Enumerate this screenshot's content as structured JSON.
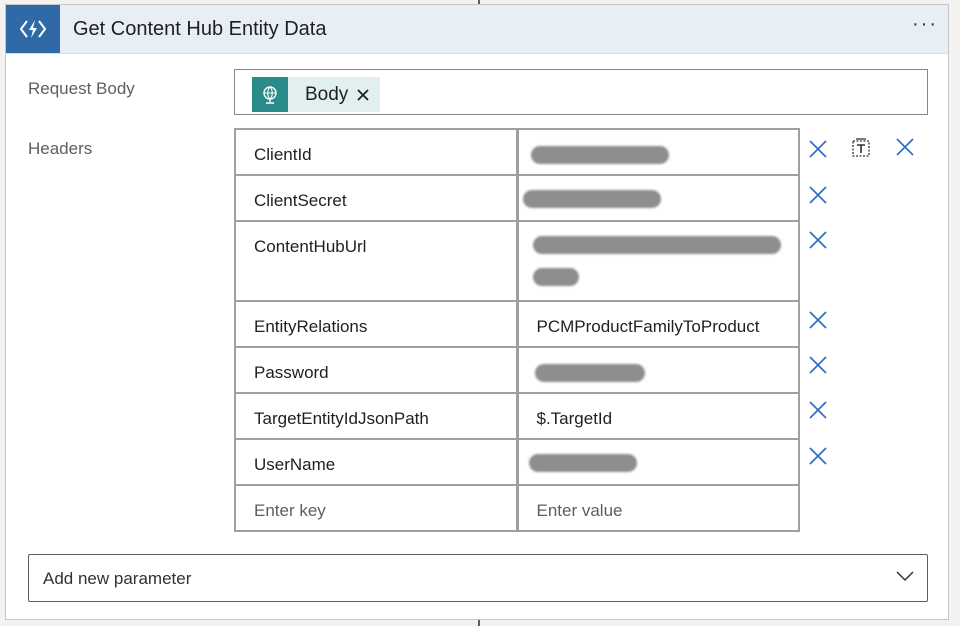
{
  "card": {
    "title": "Get Content Hub Entity Data",
    "more_label": "···",
    "icon": "azure-function-icon",
    "accent_color": "#2f6aa6"
  },
  "request_body": {
    "label": "Request Body",
    "token": {
      "label": "Body",
      "icon": "globe-icon",
      "color": "#2b8a8a"
    }
  },
  "headers": {
    "label": "Headers",
    "rows": [
      {
        "key": "ClientId",
        "value": "",
        "redacted": true
      },
      {
        "key": "ClientSecret",
        "value": "",
        "redacted": true
      },
      {
        "key": "ContentHubUrl",
        "value": "",
        "redacted": true
      },
      {
        "key": "EntityRelations",
        "value": "PCMProductFamilyToProduct",
        "redacted": false
      },
      {
        "key": "Password",
        "value": "",
        "redacted": true
      },
      {
        "key": "TargetEntityIdJsonPath",
        "value": "$.TargetId",
        "redacted": false
      },
      {
        "key": "UserName",
        "value": "",
        "redacted": true
      }
    ],
    "new_row": {
      "key_placeholder": "Enter key",
      "value_placeholder": "Enter value"
    },
    "action_icons": [
      "close-icon",
      "text-mode-icon",
      "close-icon"
    ]
  },
  "add_parameter": {
    "label": "Add new parameter",
    "icon": "chevron-down-icon"
  }
}
